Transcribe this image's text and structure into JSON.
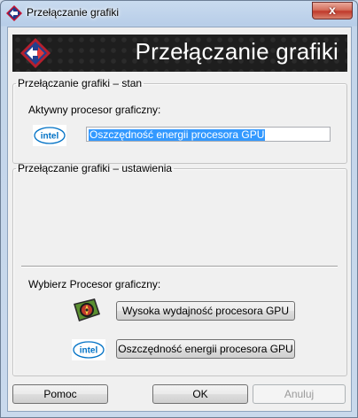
{
  "window": {
    "title": "Przełączanie grafiki",
    "close_label": "x"
  },
  "banner": {
    "title": "Przełączanie grafiki"
  },
  "status_group": {
    "legend": "Przełączanie grafiki – stan",
    "active_label": "Aktywny procesor graficzny:",
    "active_value": "Oszczędność energii procesora GPU",
    "logo_text": "intel"
  },
  "settings_group": {
    "legend": "Przełączanie grafiki – ustawienia",
    "choose_label": "Wybierz Procesor graficzny:",
    "high_perf_button": "Wysoka wydajność procesora GPU",
    "power_save_button": "Oszczędność energii procesora GPU",
    "logo_text": "intel"
  },
  "footer": {
    "help_button": "Pomoc",
    "ok_button": "OK",
    "cancel_button": "Anuluj"
  },
  "colors": {
    "banner_bg": "#1e1e1e",
    "selection": "#3399ff",
    "intel_blue": "#0071c5"
  }
}
